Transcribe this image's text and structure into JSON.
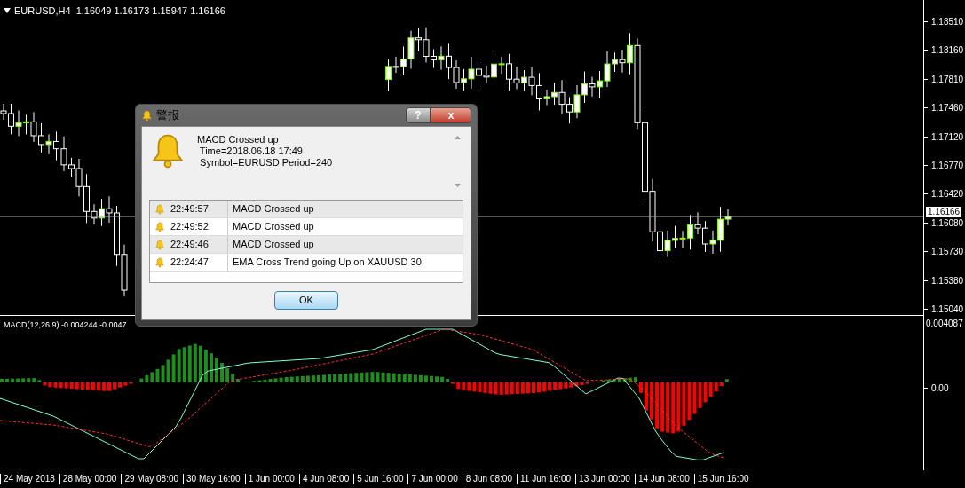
{
  "chart": {
    "header": "EURUSD,H4  1.16049 1.16173 1.15947 1.16166",
    "price_axis": [
      "1.18510",
      "1.18160",
      "1.17810",
      "1.17460",
      "1.17120",
      "1.16770",
      "1.16420",
      "1.16080",
      "1.15730",
      "1.15380",
      "1.15040"
    ],
    "current_price": "1.16166"
  },
  "macd": {
    "label": "MACD(12,26,9) -0.004244 -0.0047",
    "axis": [
      "0.004087",
      "0.00"
    ]
  },
  "time_axis": [
    "24 May 2018",
    "28 May 00:00",
    "29 May 08:00",
    "30 May 16:00",
    "1 Jun 00:00",
    "4 Jun 08:00",
    "5 Jun 16:00",
    "7 Jun 00:00",
    "8 Jun 08:00",
    "11 Jun 16:00",
    "13 Jun 00:00",
    "14 Jun 08:00",
    "15 Jun 16:00"
  ],
  "dialog": {
    "title": "警报",
    "help": "?",
    "close": "x",
    "message": [
      "MACD Crossed up",
      " Time=2018.06.18 17:49",
      " Symbol=EURUSD Period=240"
    ],
    "alerts": [
      {
        "time": "22:49:57",
        "text": "MACD Crossed up"
      },
      {
        "time": "22:49:52",
        "text": "MACD Crossed up"
      },
      {
        "time": "22:49:46",
        "text": "MACD Crossed up"
      },
      {
        "time": "22:24:47",
        "text": "EMA Cross Trend going Up on XAUUSD 30"
      }
    ],
    "ok": "OK"
  }
}
